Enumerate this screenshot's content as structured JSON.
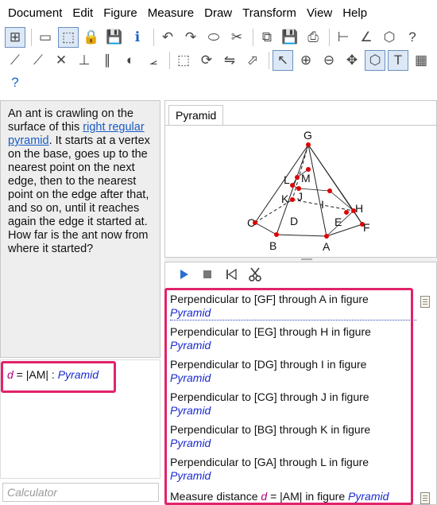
{
  "menu": [
    "Document",
    "Edit",
    "Figure",
    "Measure",
    "Draw",
    "Transform",
    "View",
    "Help"
  ],
  "toolbar": {
    "row1": [
      "outline-icon",
      "new-doc-icon",
      "select-doc-icon",
      "lock-icon",
      "save-icon",
      "info-icon",
      "undo-icon",
      "redo-icon",
      "eraser-icon",
      "delete-icon",
      "copy-icon",
      "save-figure-icon",
      "print-icon",
      "measure-tool-icon",
      "angle-tool-icon",
      "solid-icon",
      "help-shape-icon"
    ],
    "row2": [
      "point-tool-icon",
      "segment-tool-icon",
      "intersect-tool-icon",
      "perp-tool-icon",
      "parallel-tool-icon",
      "midpoint-tool-icon",
      "angle-bisector-icon",
      "move-tool-icon",
      "rotate-tool-icon",
      "reflect-tool-icon",
      "scale-tool-icon",
      "pointer-icon",
      "zoom-in-icon",
      "zoom-out-icon",
      "fit-icon",
      "cube-view-icon",
      "text-tool-icon",
      "grid-icon"
    ],
    "row3": [
      "help-icon"
    ],
    "glyphs": {
      "row1": [
        "⊞",
        "▭",
        "⬚",
        "🔒",
        "💾",
        "ℹ",
        "↶",
        "↷",
        "⬭",
        "✂",
        "⧉",
        "💾",
        "⎙",
        "⊢",
        "∠",
        "⬡",
        "?"
      ],
      "row2": [
        "⟋",
        "⟋",
        "✕",
        "⊥",
        "∥",
        "◐",
        "⦟",
        "⬚",
        "⟳",
        "⇋",
        "⬀",
        "↖",
        "⊕",
        "⊖",
        "✥",
        "⬡",
        "T",
        "▦"
      ],
      "row3": [
        "?"
      ]
    }
  },
  "problem": {
    "part1": "An ant is crawling on the surface of this ",
    "link": "right regular pyramid",
    "part2": ". It starts at a vertex on the base, goes up to the nearest point on the next edge, then to the nearest point on the edge after that, and so on, until it reaches again the edge it started at. How far is the ant now from where it started?"
  },
  "formula": {
    "var": "d",
    "eq": " = |AM| : ",
    "fig": "Pyramid"
  },
  "calculator_placeholder": "Calculator",
  "figure": {
    "tab": "Pyramid",
    "labels": {
      "G": "G",
      "L": "L",
      "M": "M",
      "K": "K",
      "J": "J",
      "I": "I",
      "H": "H",
      "C": "C",
      "D": "D",
      "E": "E",
      "F": "F",
      "B": "B",
      "A": "A"
    }
  },
  "steps": [
    {
      "text": "Perpendicular to [GF] through A in figure",
      "fig": "Pyramid"
    },
    {
      "text": "Perpendicular to [EG] through H in figure",
      "fig": "Pyramid"
    },
    {
      "text": "Perpendicular to [DG] through I in figure",
      "fig": "Pyramid"
    },
    {
      "text": "Perpendicular to [CG] through J in figure",
      "fig": "Pyramid"
    },
    {
      "text": "Perpendicular to [BG] through K in figure",
      "fig": "Pyramid"
    },
    {
      "text": "Perpendicular to [GA] through L in figure",
      "fig": "Pyramid"
    }
  ],
  "last_step": {
    "prefix": "Measure distance ",
    "var": "d",
    "eq": " = |AM| in figure ",
    "fig": "Pyramid"
  }
}
